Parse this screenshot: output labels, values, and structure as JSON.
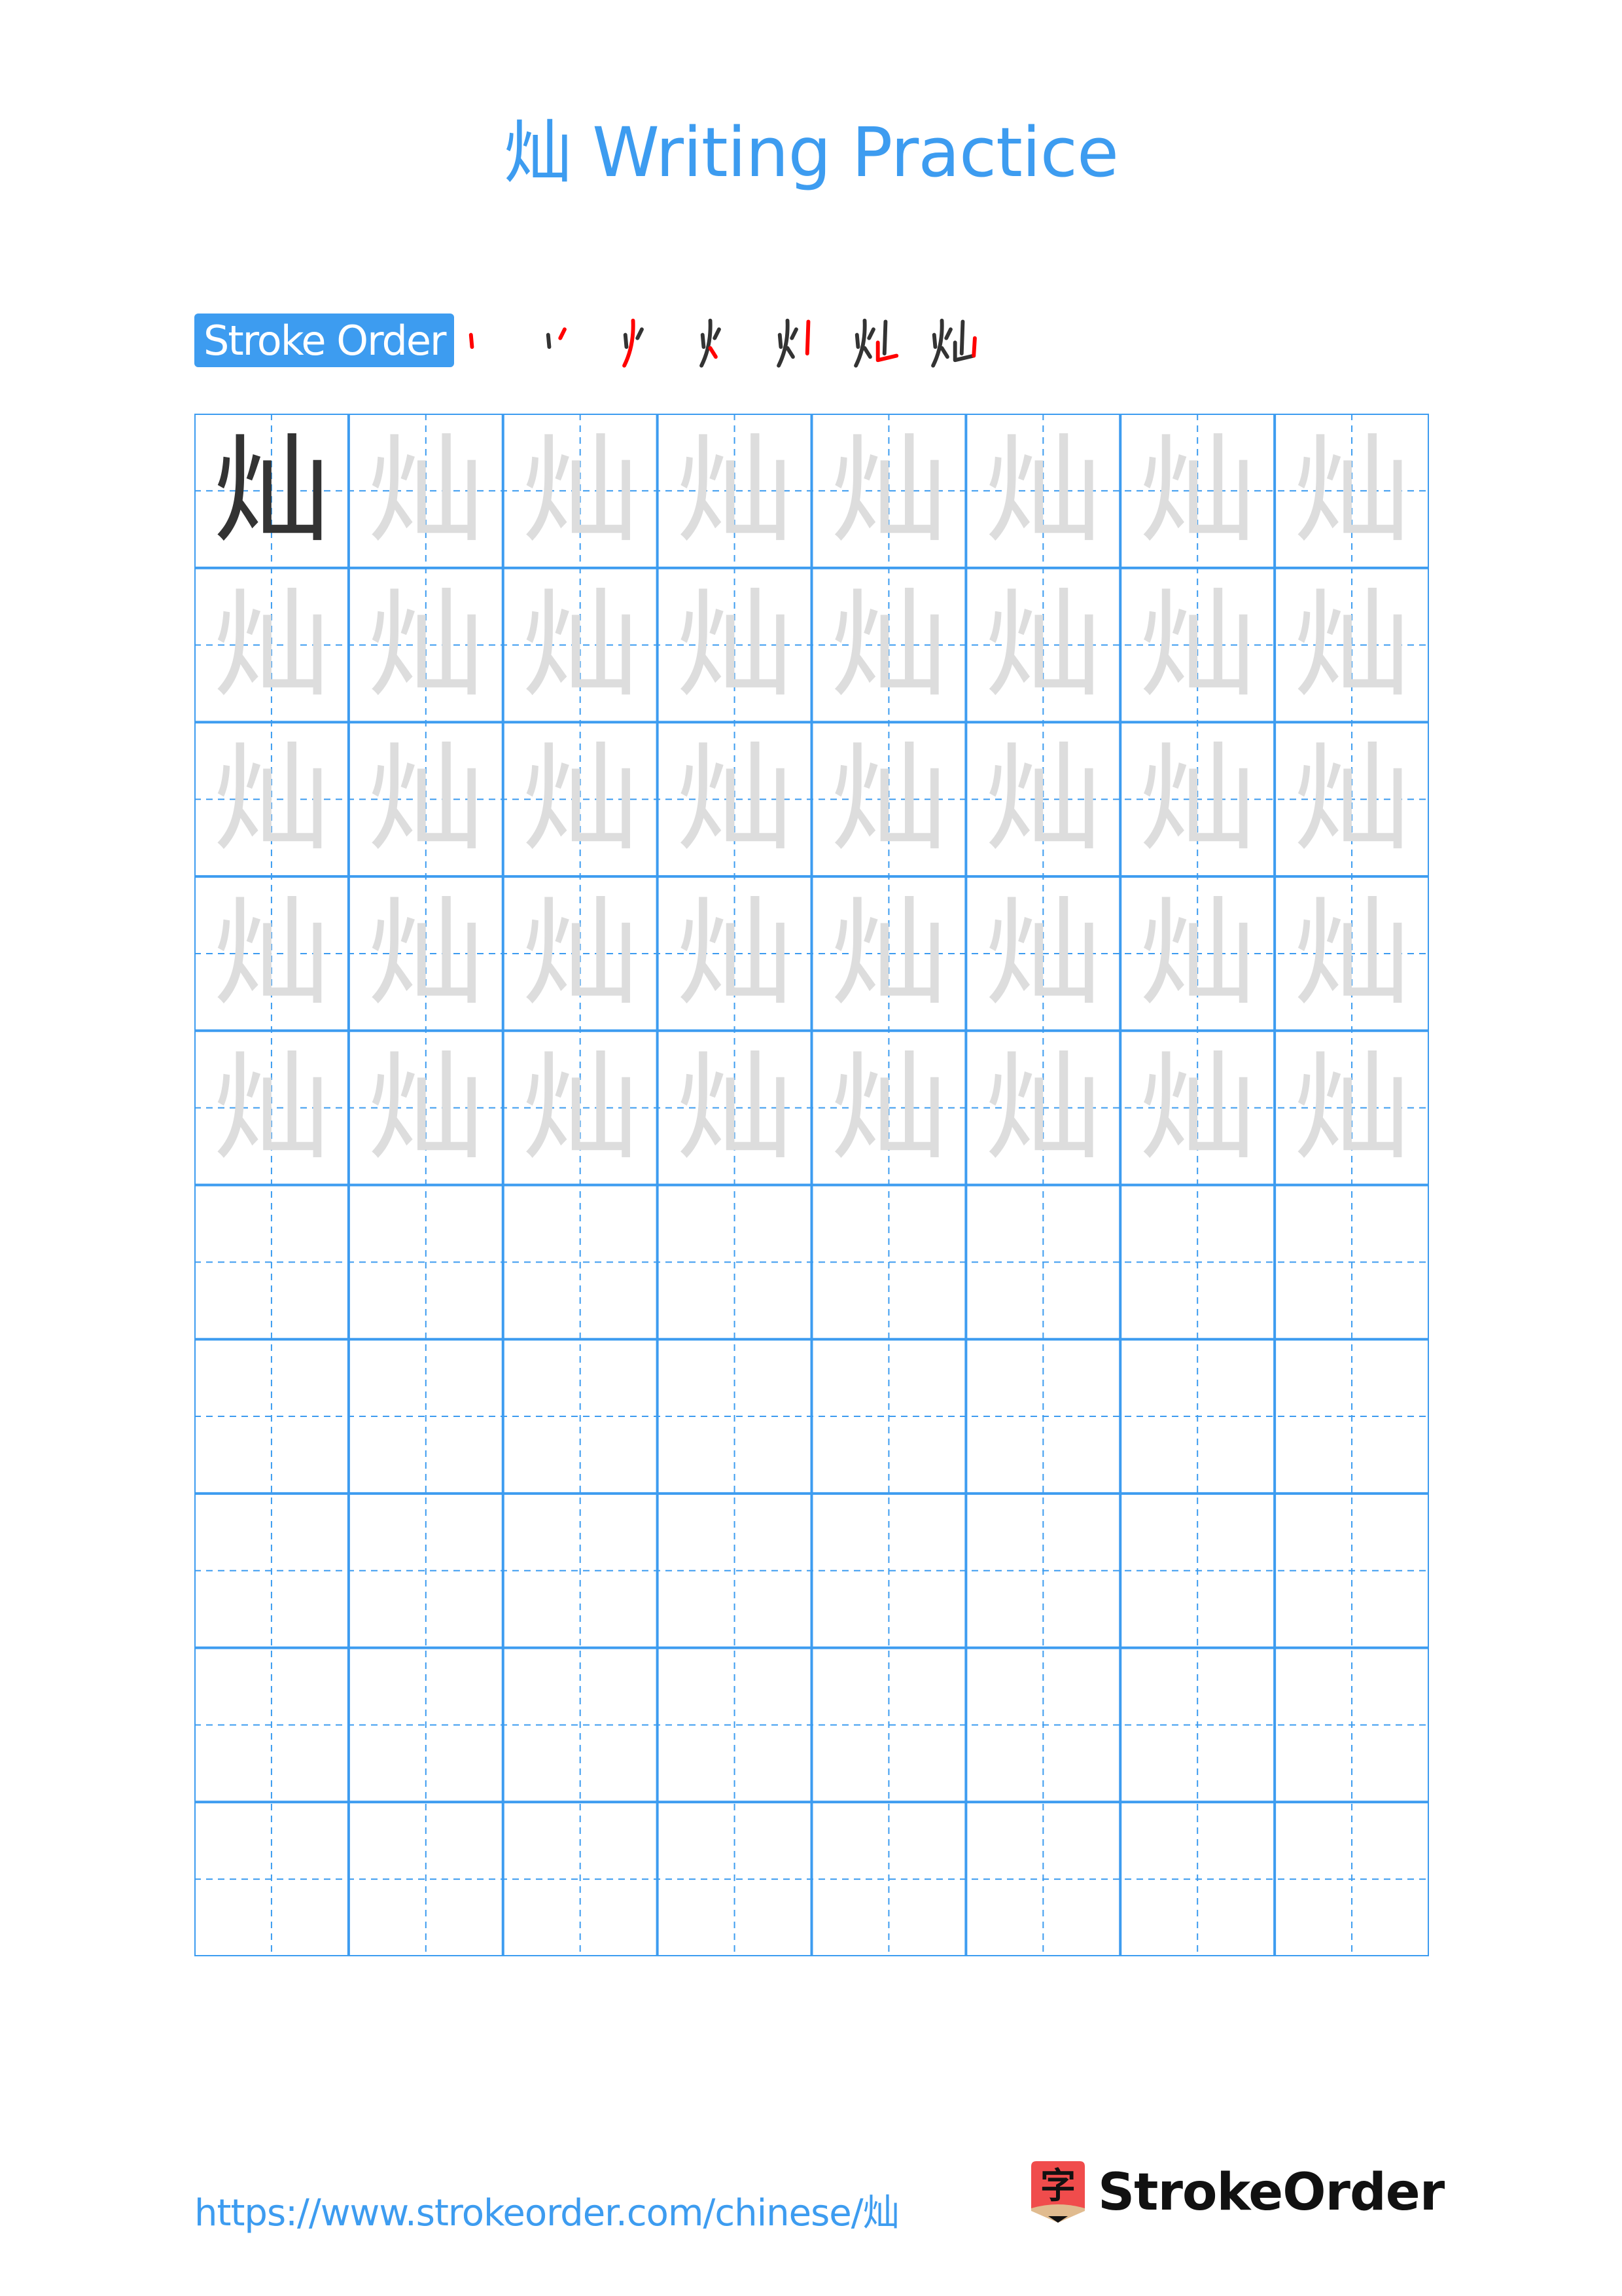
{
  "page": {
    "title": "灿 Writing Practice",
    "character": "灿"
  },
  "stroke_order": {
    "label": "Stroke Order",
    "step_count": 7,
    "steps": [
      {
        "step": 1,
        "description": "dot (left)"
      },
      {
        "step": 2,
        "description": "short left-falling (right)"
      },
      {
        "step": 3,
        "description": "left-falling"
      },
      {
        "step": 4,
        "description": "dot"
      },
      {
        "step": 5,
        "description": "vertical (center)"
      },
      {
        "step": 6,
        "description": "vertical-horizontal"
      },
      {
        "step": 7,
        "description": "vertical (right)"
      }
    ],
    "highlight_color": "#ff0000",
    "stroke_color": "#333333"
  },
  "grid": {
    "columns": 8,
    "rows": 10,
    "filled_rows": 5,
    "model_character": "灿",
    "trace_character": "灿",
    "line_color": "#3d9cf0",
    "model_color": "#333333",
    "trace_color": "#dddddd"
  },
  "footer": {
    "url": "https://www.strokeorder.com/chinese/灿",
    "logo_text": "StrokeOrder",
    "logo_glyph": "字"
  },
  "colors": {
    "accent": "#3d9cf0",
    "logo_red": "#f04c4c",
    "logo_tan": "#e0bb8f"
  }
}
